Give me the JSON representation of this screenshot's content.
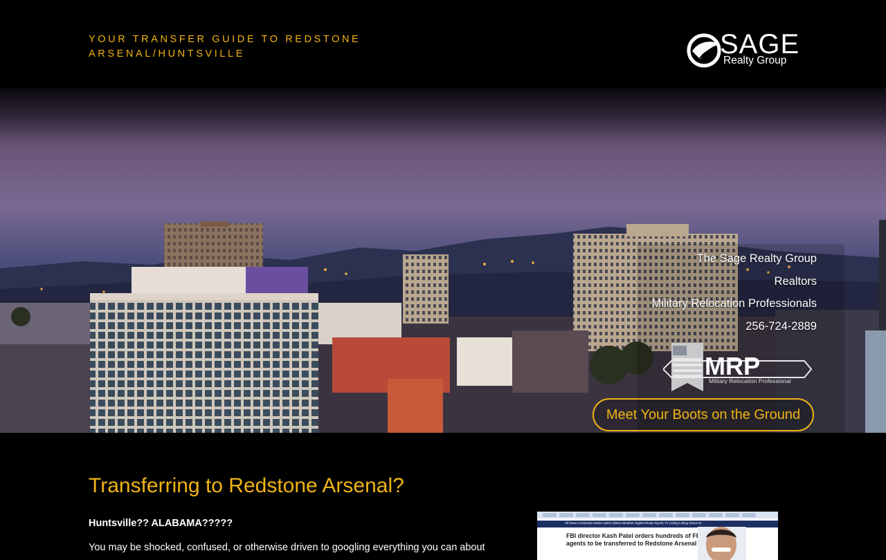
{
  "header": {
    "tagline": "YOUR TRANSFER GUIDE TO REDSTONE ARSENAL/HUNTSVILLE",
    "logo_word": "SAGE",
    "logo_sub": "Realty Group"
  },
  "hero": {
    "info_lines": [
      "The Sage Realty Group",
      "Realtors",
      "Military Relocation Professionals",
      "256-724-2889"
    ],
    "mrp_badge_title": "MRP",
    "mrp_badge_sub": "Military Relocation Professional",
    "cta_label": "Meet Your Boots on the Ground"
  },
  "content": {
    "title": "Transferring to Redstone Arsenal?",
    "lead": "Huntsville??  ALABAMA?????",
    "paragraph": "You may be shocked, confused, or otherwise driven to googling everything you can about"
  },
  "thumbnail": {
    "headline": "FBI director Kash Patel orders hundreds of FBI agents to be transferred to Redstone Arsenal",
    "nav_text": "All News Livestream   News   Latest Videos   Weather   Digital Shows   Sports   TV Listing Listing   About Us"
  },
  "colors": {
    "accent": "#f0b414",
    "background": "#000000"
  }
}
